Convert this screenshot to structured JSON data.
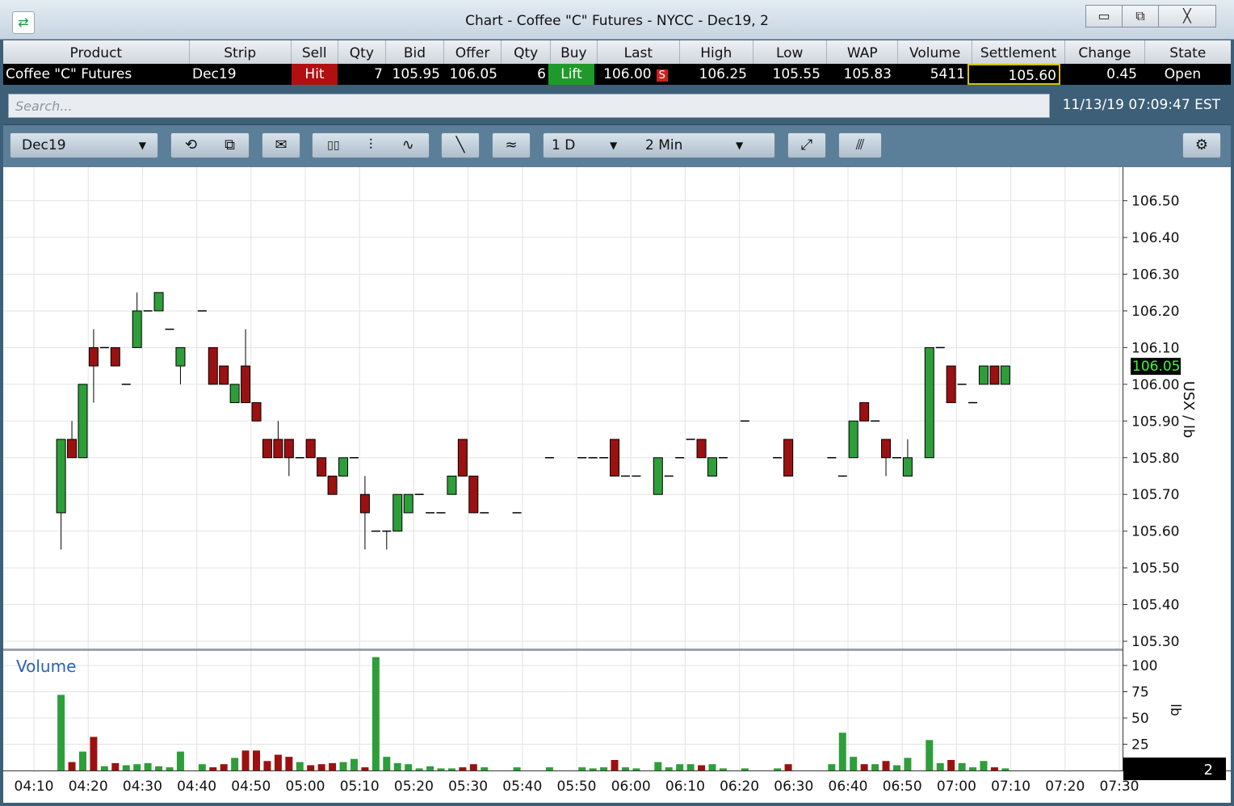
{
  "window": {
    "title": "Chart - Coffee \"C\" Futures - NYCC - Dec19, 2",
    "app_icon": "swap-arrows-icon",
    "buttons": [
      "minimize-icon",
      "maximize-icon",
      "close-icon"
    ],
    "minimize_glyph": "▭",
    "maximize_glyph": "⧉",
    "close_glyph": "╳"
  },
  "quote": {
    "headers": [
      "Product",
      "Strip",
      "Sell",
      "Qty",
      "Bid",
      "Offer",
      "Qty",
      "Buy",
      "Last",
      "High",
      "Low",
      "WAP",
      "Volume",
      "Settlement",
      "Change",
      "State"
    ],
    "product": "Coffee \"C\" Futures",
    "strip": "Dec19",
    "sell_label": "Hit",
    "bid_qty": "7",
    "bid": "105.95",
    "offer": "106.05",
    "offer_qty": "6",
    "buy_label": "Lift",
    "last": "106.00",
    "last_flag": "S",
    "high": "106.25",
    "low": "105.55",
    "wap": "105.83",
    "volume": "5411",
    "settlement": "105.60",
    "change": "0.45",
    "state": "Open"
  },
  "search": {
    "placeholder": "Search..."
  },
  "clock": "11/13/19 07:09:47 EST",
  "toolbar": {
    "strip_select": "Dec19",
    "range_select": "1 D",
    "interval_select": "2 Min",
    "dropdown_glyph": "▼",
    "icons": [
      "undo-icon",
      "detach-icon",
      "envelope-chart-icon",
      "candlestick-icon",
      "ohlc-bar-icon",
      "line-chart-icon",
      "draw-line-icon",
      "study-icon",
      "fit-screen-icon",
      "volume-profile-icon",
      "settings-gear-icon"
    ],
    "glyphs": {
      "undo": "⟲",
      "detach": "⧉",
      "envelope": "✉",
      "candle": "▯▯",
      "ohlc": "⫶",
      "line": "∿",
      "draw": "╲",
      "study": "≈",
      "fit": "⤢",
      "profile": "⫻",
      "gear": "⚙"
    }
  },
  "colors": {
    "up": "#2e9e3a",
    "down": "#9b1111",
    "grid": "#e3e3e3",
    "last_badge_bg": "#000000",
    "last_badge_fg": "#33ff33"
  },
  "chart_data": {
    "type": "candlestick",
    "x_tick_labels": [
      "04:10",
      "04:20",
      "04:30",
      "04:40",
      "04:50",
      "05:00",
      "05:10",
      "05:20",
      "05:30",
      "05:40",
      "05:50",
      "06:00",
      "06:10",
      "06:20",
      "06:30",
      "06:40",
      "06:50",
      "07:00",
      "07:10",
      "07:20",
      "07:30"
    ],
    "price_axis": {
      "label": "USX / lb",
      "ylim": [
        105.25,
        106.55
      ],
      "ticks": [
        "106.50",
        "106.40",
        "106.30",
        "106.20",
        "106.10",
        "106.00",
        "105.90",
        "105.80",
        "105.70",
        "105.60",
        "105.50",
        "105.40",
        "105.30"
      ],
      "last_price_badge": "106.05"
    },
    "volume_panel": {
      "title": "Volume",
      "axis_label": "lb",
      "ylim": [
        0,
        108
      ],
      "ticks": [
        "100",
        "75",
        "50",
        "25"
      ],
      "badge": "2"
    },
    "bars": [
      {
        "t": "04:15",
        "o": 105.65,
        "h": 105.85,
        "l": 105.55,
        "c": 105.85,
        "v": 72
      },
      {
        "t": "04:17",
        "o": 105.85,
        "h": 105.9,
        "l": 105.8,
        "c": 105.8,
        "v": 8
      },
      {
        "t": "04:19",
        "o": 105.8,
        "h": 106.0,
        "l": 105.8,
        "c": 106.0,
        "v": 18
      },
      {
        "t": "04:21",
        "o": 106.1,
        "h": 106.15,
        "l": 105.95,
        "c": 106.05,
        "v": 32
      },
      {
        "t": "04:23",
        "o": 106.1,
        "h": 106.1,
        "l": 106.1,
        "c": 106.1,
        "v": 4
      },
      {
        "t": "04:25",
        "o": 106.1,
        "h": 106.1,
        "l": 106.05,
        "c": 106.05,
        "v": 7
      },
      {
        "t": "04:27",
        "o": 106.0,
        "h": 106.0,
        "l": 106.0,
        "c": 106.0,
        "v": 5
      },
      {
        "t": "04:29",
        "o": 106.1,
        "h": 106.25,
        "l": 106.1,
        "c": 106.2,
        "v": 6
      },
      {
        "t": "04:31",
        "o": 106.2,
        "h": 106.2,
        "l": 106.2,
        "c": 106.2,
        "v": 7
      },
      {
        "t": "04:33",
        "o": 106.2,
        "h": 106.25,
        "l": 106.2,
        "c": 106.25,
        "v": 4
      },
      {
        "t": "04:35",
        "o": 106.15,
        "h": 106.15,
        "l": 106.15,
        "c": 106.15,
        "v": 3
      },
      {
        "t": "04:37",
        "o": 106.05,
        "h": 106.1,
        "l": 106.0,
        "c": 106.1,
        "v": 18
      },
      {
        "t": "04:41",
        "o": 106.2,
        "h": 106.2,
        "l": 106.2,
        "c": 106.2,
        "v": 6
      },
      {
        "t": "04:43",
        "o": 106.1,
        "h": 106.1,
        "l": 106.0,
        "c": 106.0,
        "v": 3
      },
      {
        "t": "04:45",
        "o": 106.05,
        "h": 106.05,
        "l": 106.0,
        "c": 106.0,
        "v": 6
      },
      {
        "t": "04:47",
        "o": 105.95,
        "h": 106.0,
        "l": 105.95,
        "c": 106.0,
        "v": 12
      },
      {
        "t": "04:49",
        "o": 106.05,
        "h": 106.15,
        "l": 105.95,
        "c": 105.95,
        "v": 19
      },
      {
        "t": "04:51",
        "o": 105.95,
        "h": 105.95,
        "l": 105.9,
        "c": 105.9,
        "v": 19
      },
      {
        "t": "04:53",
        "o": 105.85,
        "h": 105.85,
        "l": 105.8,
        "c": 105.8,
        "v": 9
      },
      {
        "t": "04:55",
        "o": 105.85,
        "h": 105.9,
        "l": 105.8,
        "c": 105.8,
        "v": 15
      },
      {
        "t": "04:57",
        "o": 105.85,
        "h": 105.85,
        "l": 105.75,
        "c": 105.8,
        "v": 13
      },
      {
        "t": "04:59",
        "o": 105.8,
        "h": 105.8,
        "l": 105.8,
        "c": 105.8,
        "v": 8
      },
      {
        "t": "05:01",
        "o": 105.85,
        "h": 105.85,
        "l": 105.8,
        "c": 105.8,
        "v": 5
      },
      {
        "t": "05:03",
        "o": 105.8,
        "h": 105.8,
        "l": 105.75,
        "c": 105.75,
        "v": 6
      },
      {
        "t": "05:05",
        "o": 105.75,
        "h": 105.75,
        "l": 105.7,
        "c": 105.7,
        "v": 7
      },
      {
        "t": "05:07",
        "o": 105.75,
        "h": 105.8,
        "l": 105.75,
        "c": 105.8,
        "v": 8
      },
      {
        "t": "05:09",
        "o": 105.8,
        "h": 105.8,
        "l": 105.8,
        "c": 105.8,
        "v": 11
      },
      {
        "t": "05:11",
        "o": 105.7,
        "h": 105.75,
        "l": 105.55,
        "c": 105.65,
        "v": 3
      },
      {
        "t": "05:13",
        "o": 105.6,
        "h": 105.6,
        "l": 105.6,
        "c": 105.6,
        "v": 108
      },
      {
        "t": "05:15",
        "o": 105.6,
        "h": 105.6,
        "l": 105.55,
        "c": 105.6,
        "v": 13
      },
      {
        "t": "05:17",
        "o": 105.6,
        "h": 105.7,
        "l": 105.6,
        "c": 105.7,
        "v": 7
      },
      {
        "t": "05:19",
        "o": 105.65,
        "h": 105.7,
        "l": 105.65,
        "c": 105.7,
        "v": 6
      },
      {
        "t": "05:21",
        "o": 105.7,
        "h": 105.7,
        "l": 105.7,
        "c": 105.7,
        "v": 2
      },
      {
        "t": "05:23",
        "o": 105.65,
        "h": 105.65,
        "l": 105.65,
        "c": 105.65,
        "v": 4
      },
      {
        "t": "05:25",
        "o": 105.65,
        "h": 105.65,
        "l": 105.65,
        "c": 105.65,
        "v": 2
      },
      {
        "t": "05:27",
        "o": 105.7,
        "h": 105.75,
        "l": 105.7,
        "c": 105.75,
        "v": 2
      },
      {
        "t": "05:29",
        "o": 105.85,
        "h": 105.85,
        "l": 105.75,
        "c": 105.75,
        "v": 3
      },
      {
        "t": "05:31",
        "o": 105.75,
        "h": 105.75,
        "l": 105.65,
        "c": 105.65,
        "v": 6
      },
      {
        "t": "05:33",
        "o": 105.65,
        "h": 105.65,
        "l": 105.65,
        "c": 105.65,
        "v": 3
      },
      {
        "t": "05:39",
        "o": 105.65,
        "h": 105.65,
        "l": 105.65,
        "c": 105.65,
        "v": 3
      },
      {
        "t": "05:45",
        "o": 105.8,
        "h": 105.8,
        "l": 105.8,
        "c": 105.8,
        "v": 3
      },
      {
        "t": "05:51",
        "o": 105.8,
        "h": 105.8,
        "l": 105.8,
        "c": 105.8,
        "v": 3
      },
      {
        "t": "05:53",
        "o": 105.8,
        "h": 105.8,
        "l": 105.8,
        "c": 105.8,
        "v": 2
      },
      {
        "t": "05:55",
        "o": 105.8,
        "h": 105.8,
        "l": 105.8,
        "c": 105.8,
        "v": 3
      },
      {
        "t": "05:57",
        "o": 105.85,
        "h": 105.85,
        "l": 105.75,
        "c": 105.75,
        "v": 10
      },
      {
        "t": "05:59",
        "o": 105.75,
        "h": 105.75,
        "l": 105.75,
        "c": 105.75,
        "v": 3
      },
      {
        "t": "06:01",
        "o": 105.75,
        "h": 105.75,
        "l": 105.75,
        "c": 105.75,
        "v": 2
      },
      {
        "t": "06:05",
        "o": 105.7,
        "h": 105.8,
        "l": 105.7,
        "c": 105.8,
        "v": 8
      },
      {
        "t": "06:07",
        "o": 105.75,
        "h": 105.75,
        "l": 105.75,
        "c": 105.75,
        "v": 3
      },
      {
        "t": "06:09",
        "o": 105.8,
        "h": 105.8,
        "l": 105.8,
        "c": 105.8,
        "v": 6
      },
      {
        "t": "06:11",
        "o": 105.85,
        "h": 105.85,
        "l": 105.85,
        "c": 105.85,
        "v": 6
      },
      {
        "t": "06:13",
        "o": 105.85,
        "h": 105.85,
        "l": 105.8,
        "c": 105.8,
        "v": 5
      },
      {
        "t": "06:15",
        "o": 105.75,
        "h": 105.8,
        "l": 105.75,
        "c": 105.8,
        "v": 6
      },
      {
        "t": "06:17",
        "o": 105.8,
        "h": 105.8,
        "l": 105.8,
        "c": 105.8,
        "v": 2
      },
      {
        "t": "06:21",
        "o": 105.9,
        "h": 105.9,
        "l": 105.9,
        "c": 105.9,
        "v": 2
      },
      {
        "t": "06:27",
        "o": 105.8,
        "h": 105.8,
        "l": 105.8,
        "c": 105.8,
        "v": 2
      },
      {
        "t": "06:29",
        "o": 105.85,
        "h": 105.85,
        "l": 105.75,
        "c": 105.75,
        "v": 6
      },
      {
        "t": "06:37",
        "o": 105.8,
        "h": 105.8,
        "l": 105.8,
        "c": 105.8,
        "v": 6
      },
      {
        "t": "06:39",
        "o": 105.75,
        "h": 105.75,
        "l": 105.75,
        "c": 105.75,
        "v": 36
      },
      {
        "t": "06:41",
        "o": 105.8,
        "h": 105.9,
        "l": 105.8,
        "c": 105.9,
        "v": 13
      },
      {
        "t": "06:43",
        "o": 105.95,
        "h": 105.95,
        "l": 105.9,
        "c": 105.9,
        "v": 6
      },
      {
        "t": "06:45",
        "o": 105.9,
        "h": 105.9,
        "l": 105.9,
        "c": 105.9,
        "v": 6
      },
      {
        "t": "06:47",
        "o": 105.85,
        "h": 105.85,
        "l": 105.75,
        "c": 105.8,
        "v": 9
      },
      {
        "t": "06:49",
        "o": 105.8,
        "h": 105.8,
        "l": 105.8,
        "c": 105.8,
        "v": 5
      },
      {
        "t": "06:51",
        "o": 105.75,
        "h": 105.85,
        "l": 105.75,
        "c": 105.8,
        "v": 12
      },
      {
        "t": "06:55",
        "o": 105.8,
        "h": 106.1,
        "l": 105.8,
        "c": 106.1,
        "v": 29
      },
      {
        "t": "06:57",
        "o": 106.1,
        "h": 106.1,
        "l": 106.1,
        "c": 106.1,
        "v": 7
      },
      {
        "t": "06:59",
        "o": 106.05,
        "h": 106.05,
        "l": 105.95,
        "c": 105.95,
        "v": 10
      },
      {
        "t": "07:01",
        "o": 106.0,
        "h": 106.0,
        "l": 106.0,
        "c": 106.0,
        "v": 7
      },
      {
        "t": "07:03",
        "o": 105.95,
        "h": 105.95,
        "l": 105.95,
        "c": 105.95,
        "v": 3
      },
      {
        "t": "07:05",
        "o": 106.0,
        "h": 106.05,
        "l": 106.0,
        "c": 106.05,
        "v": 9
      },
      {
        "t": "07:07",
        "o": 106.05,
        "h": 106.05,
        "l": 106.0,
        "c": 106.0,
        "v": 3
      },
      {
        "t": "07:09",
        "o": 106.0,
        "h": 106.05,
        "l": 106.0,
        "c": 106.05,
        "v": 2
      }
    ]
  }
}
